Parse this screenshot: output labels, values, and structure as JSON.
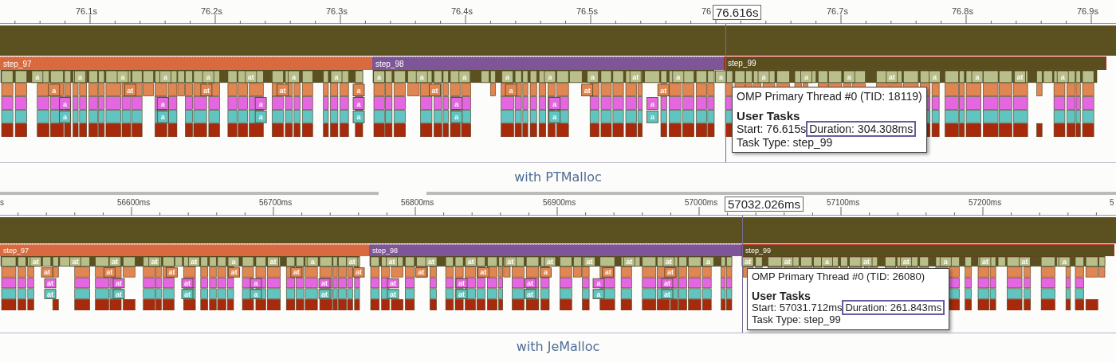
{
  "panels": [
    {
      "ruler": {
        "ticks": [
          "76.1s",
          "76.2s",
          "76.3s",
          "76.4s",
          "76.5s",
          "76",
          "76.7s",
          "76.8s",
          "76.9s"
        ]
      },
      "cursor": {
        "time": "76.616s"
      },
      "steps": [
        {
          "label": "step_97",
          "color": "#d9693f",
          "selected": false
        },
        {
          "label": "step_98",
          "color": "#7e5596",
          "selected": false
        },
        {
          "label": "step_99",
          "color": "#5b4e1e",
          "selected": true
        }
      ],
      "block_labels": [
        [
          "a",
          "a",
          "a",
          "a",
          "a",
          "at",
          "a",
          "a",
          "a",
          "a",
          "a",
          "a",
          "a",
          "a",
          "at",
          "a",
          "a",
          "a",
          "a",
          "a",
          "at",
          "a",
          "a",
          "at",
          "a"
        ],
        [
          "a",
          "at",
          "at",
          "at",
          "a",
          "at",
          "a",
          "at",
          "at"
        ],
        [
          "a",
          "a",
          "a",
          "a",
          "a",
          "a",
          "a"
        ],
        [
          "a",
          "a",
          "a",
          "a",
          "a",
          "a",
          "a"
        ]
      ],
      "tooltip": {
        "title": "OMP Primary Thread #0 (TID: 18119)",
        "heading": "User Tasks",
        "start": "Start: 76.615s",
        "duration": "Duration: 304.308ms",
        "task_type": "Task Type: step_99"
      },
      "caption": "with PTMalloc"
    },
    {
      "ruler": {
        "ticks": [
          "s",
          "56600ms",
          "56700ms",
          "56800ms",
          "56900ms",
          "57000ms",
          "57100ms",
          "57200ms",
          "5"
        ]
      },
      "cursor": {
        "time": "57032.026ms"
      },
      "steps": [
        {
          "label": "step_97",
          "color": "#d9693f",
          "selected": false
        },
        {
          "label": "step_98",
          "color": "#7e5596",
          "selected": false
        },
        {
          "label": "step_99",
          "color": "#5b4e1e",
          "selected": true
        }
      ],
      "block_labels": [
        [
          "at",
          "at",
          "at",
          "at",
          "at",
          "a",
          "at",
          "a",
          "at",
          "at",
          "at",
          "at",
          "at",
          "at",
          "at",
          "at",
          "at",
          "a",
          "at",
          "at",
          "a",
          "at",
          "at",
          "a",
          "at",
          "at",
          "a"
        ],
        [
          "at",
          "at",
          "at",
          "at",
          "at",
          "at",
          "at",
          "at",
          "a",
          "at",
          "at"
        ],
        [
          "at",
          "at",
          "at",
          "a",
          "at",
          "at",
          "at",
          "at",
          "a",
          "at"
        ],
        [
          "at",
          "at",
          "at",
          "a",
          "at",
          "at",
          "at",
          "at",
          "a",
          "at"
        ]
      ],
      "tooltip": {
        "title": "OMP Primary Thread #0 (TID: 26080)",
        "heading": "User Tasks",
        "start": "Start: 57031.712ms",
        "duration": "Duration: 261.843ms",
        "task_type": "Task Type: step_99"
      },
      "caption": "with JeMalloc"
    }
  ]
}
